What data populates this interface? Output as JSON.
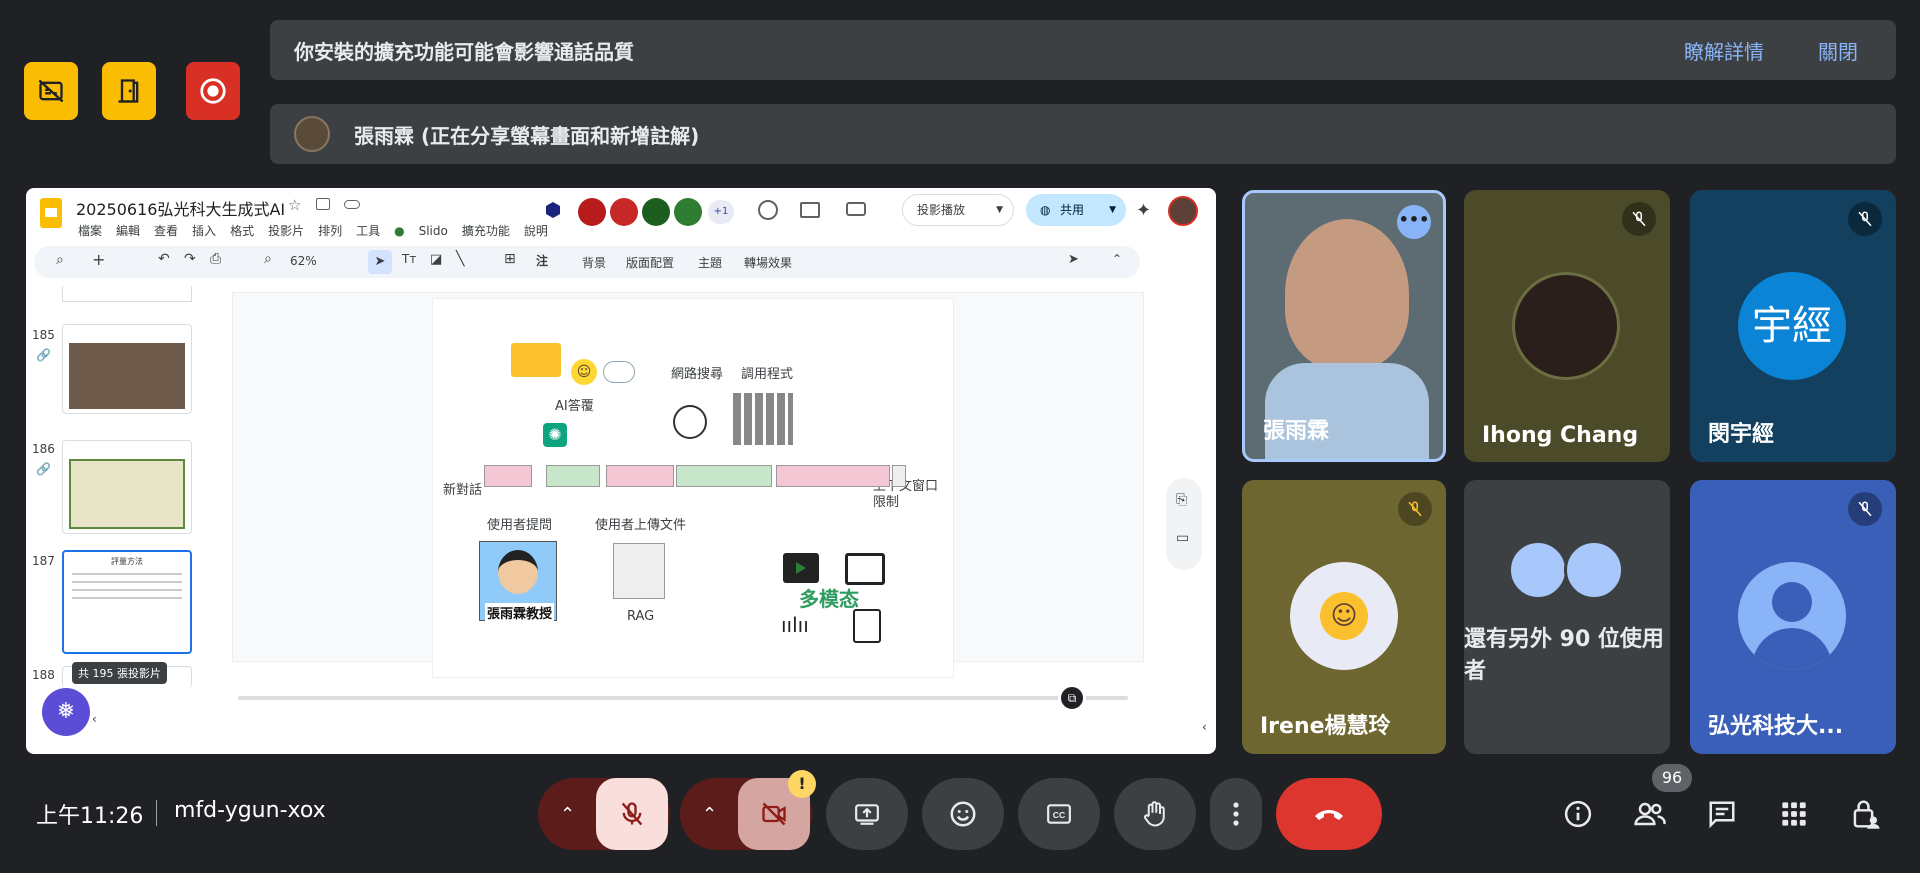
{
  "top_buttons": [
    {
      "name": "captions-off-icon",
      "color": "#fbbc04"
    },
    {
      "name": "door-icon",
      "color": "#fbbc04"
    },
    {
      "name": "record-icon",
      "color": "#d93025"
    }
  ],
  "notice": {
    "text": "你安裝的擴充功能可能會影響通話品質",
    "learn_more": "瞭解詳情",
    "close": "關閉"
  },
  "presenter": {
    "text": "張雨霖 (正在分享螢幕畫面和新增註解)"
  },
  "slides_app": {
    "doc_title": "20250616弘光科大生成式AI",
    "menu": [
      "檔案",
      "編輯",
      "查看",
      "插入",
      "格式",
      "投影片",
      "排列",
      "工具",
      "Slido",
      "擴充功能",
      "說明"
    ],
    "collab_more": "+1",
    "slideshow": "投影播放",
    "share": "共用",
    "toolbar": {
      "zoom": "62%",
      "background": "背景",
      "layout": "版面配置",
      "theme": "主題",
      "transition": "轉場效果"
    },
    "thumbs": [
      {
        "num": "185"
      },
      {
        "num": "186"
      },
      {
        "num": "187",
        "title": "評量方法"
      },
      {
        "num": "188"
      }
    ],
    "slide_count": "共 195 張投影片",
    "slide": {
      "ai_assistant": "AI答覆",
      "web_search": "網路搜尋",
      "call_program": "調用程式",
      "new_chat": "新對話",
      "context_limit": "上下文窗口\n限制",
      "user_question": "使用者提問",
      "user_upload": "使用者上傳文件",
      "professor": "張雨霖教授",
      "rag": "RAG",
      "multimodal": "多模态"
    }
  },
  "participants": [
    {
      "name": "張雨霖"
    },
    {
      "name": "Ihong Chang"
    },
    {
      "name": "閔宇經",
      "initials": "宇經"
    },
    {
      "name": "Irene楊慧玲"
    },
    {
      "name": "還有另外 90 位使用者"
    },
    {
      "name": "弘光科技大..."
    }
  ],
  "footer": {
    "time": "上午11:26",
    "meeting_code": "mfd-ygun-xox",
    "people_count": "96",
    "cam_warning": "!"
  }
}
